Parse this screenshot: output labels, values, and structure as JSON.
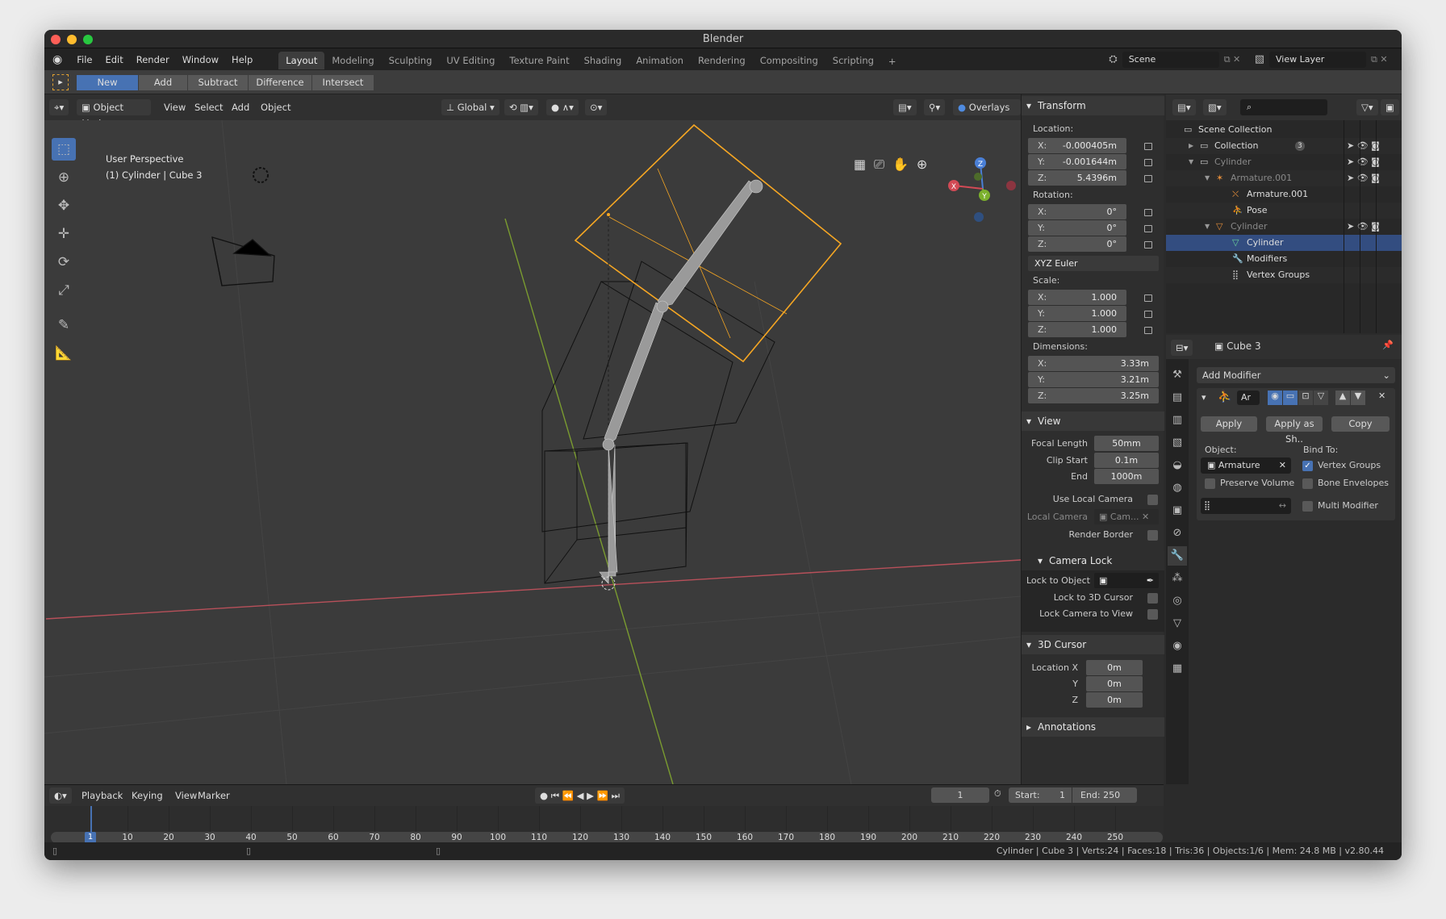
{
  "window": {
    "title": "Blender"
  },
  "menu": [
    "File",
    "Edit",
    "Render",
    "Window",
    "Help"
  ],
  "workspaces": [
    {
      "label": "Layout",
      "active": true
    },
    {
      "label": "Modeling"
    },
    {
      "label": "Sculpting"
    },
    {
      "label": "UV Editing"
    },
    {
      "label": "Texture Paint"
    },
    {
      "label": "Shading"
    },
    {
      "label": "Animation"
    },
    {
      "label": "Rendering"
    },
    {
      "label": "Compositing"
    },
    {
      "label": "Scripting"
    }
  ],
  "add_workspace": "+",
  "scene": {
    "name": "Scene",
    "view_layer": "View Layer"
  },
  "tool_header": {
    "modes": [
      "New",
      "Add",
      "Subtract",
      "Difference",
      "Intersect"
    ],
    "active": "New"
  },
  "viewport_header": {
    "mode": "Object Mode",
    "menus": [
      "View",
      "Select",
      "Add",
      "Object"
    ],
    "orientation": "Global",
    "overlays": "Overlays",
    "shading": "Shading"
  },
  "viewport": {
    "perspective": "User Perspective",
    "object_info": "(1) Cylinder | Cube 3",
    "gizmo_axes": [
      "X",
      "Y",
      "Z"
    ]
  },
  "colors": {
    "accent": "#4772b3",
    "selected_orange": "#f5a623",
    "x_axis": "#c8505a",
    "y_axis": "#8ab33a",
    "panel": "#2e2e2e"
  },
  "npanel": {
    "transform": {
      "title": "Transform",
      "location_label": "Location:",
      "location": [
        {
          "k": "X:",
          "v": "-0.000405m"
        },
        {
          "k": "Y:",
          "v": "-0.001644m"
        },
        {
          "k": "Z:",
          "v": "5.4396m"
        }
      ],
      "rotation_label": "Rotation:",
      "rotation": [
        {
          "k": "X:",
          "v": "0°"
        },
        {
          "k": "Y:",
          "v": "0°"
        },
        {
          "k": "Z:",
          "v": "0°"
        }
      ],
      "rotation_mode": "XYZ Euler",
      "scale_label": "Scale:",
      "scale": [
        {
          "k": "X:",
          "v": "1.000"
        },
        {
          "k": "Y:",
          "v": "1.000"
        },
        {
          "k": "Z:",
          "v": "1.000"
        }
      ],
      "dimensions_label": "Dimensions:",
      "dimensions": [
        {
          "k": "X:",
          "v": "3.33m"
        },
        {
          "k": "Y:",
          "v": "3.21m"
        },
        {
          "k": "Z:",
          "v": "3.25m"
        }
      ]
    },
    "view": {
      "title": "View",
      "focal_length_label": "Focal Length",
      "focal_length": "50mm",
      "clip_start_label": "Clip Start",
      "clip_start": "0.1m",
      "clip_end_label": "End",
      "clip_end": "1000m",
      "use_local_camera": "Use Local Camera",
      "local_camera_label": "Local Camera",
      "local_camera": "Cam...",
      "render_border": "Render Border"
    },
    "camera_lock": {
      "title": "Camera Lock",
      "lock_to_object": "Lock to Object",
      "lock_to_cursor": "Lock to 3D Cursor",
      "lock_camera_to_view": "Lock Camera to View"
    },
    "cursor": {
      "title": "3D Cursor",
      "location_x_label": "Location X",
      "y_label": "Y",
      "z_label": "Z",
      "x": "0m",
      "y": "0m",
      "z": "0m"
    },
    "annotations": {
      "title": "Annotations"
    }
  },
  "outliner": {
    "rows": [
      {
        "label": "Scene Collection",
        "depth": 0,
        "icon": "collection-icon"
      },
      {
        "label": "Collection",
        "depth": 1,
        "icon": "collection-icon",
        "count": "3"
      },
      {
        "label": "Cylinder",
        "depth": 1,
        "icon": "collection-icon",
        "dim": true
      },
      {
        "label": "Armature.001",
        "depth": 2,
        "icon": "armature-icon",
        "dim": true
      },
      {
        "label": "Armature.001",
        "depth": 3,
        "icon": "armature-data-icon"
      },
      {
        "label": "Pose",
        "depth": 3,
        "icon": "pose-icon"
      },
      {
        "label": "Cylinder",
        "depth": 2,
        "icon": "mesh-object-icon",
        "dim": true
      },
      {
        "label": "Cylinder",
        "depth": 3,
        "icon": "mesh-data-icon",
        "selected": true
      },
      {
        "label": "Modifiers",
        "depth": 3,
        "icon": "wrench-icon"
      },
      {
        "label": "Vertex Groups",
        "depth": 3,
        "icon": "vertex-groups-icon"
      }
    ]
  },
  "properties": {
    "object_name": "Cube 3",
    "add_modifier": "Add Modifier",
    "modifier_name": "Ar",
    "apply": "Apply",
    "apply_as_shape": "Apply as Sh..",
    "copy": "Copy",
    "object_label": "Object:",
    "object_value": "Armature",
    "bind_to_label": "Bind To:",
    "vertex_groups": "Vertex Groups",
    "vertex_groups_checked": true,
    "preserve_volume": "Preserve Volume",
    "bone_envelopes": "Bone Envelopes",
    "multi_modifier": "Multi Modifier",
    "invert_icon": "↔"
  },
  "timeline": {
    "menus": [
      "Playback",
      "Keying",
      "View",
      "Marker"
    ],
    "current_frame": "1",
    "start_label": "Start:",
    "start": "1",
    "end_label": "End:",
    "end": "250",
    "ticks": [
      "10",
      "20",
      "30",
      "40",
      "50",
      "60",
      "70",
      "80",
      "90",
      "100",
      "110",
      "120",
      "130",
      "140",
      "150",
      "160",
      "170",
      "180",
      "190",
      "200",
      "210",
      "220",
      "230",
      "240",
      "250"
    ],
    "playhead": "1"
  },
  "status": {
    "text": "Cylinder | Cube 3 | Verts:24 | Faces:18 | Tris:36 | Objects:1/6 | Mem: 24.8 MB | v2.80.44"
  }
}
